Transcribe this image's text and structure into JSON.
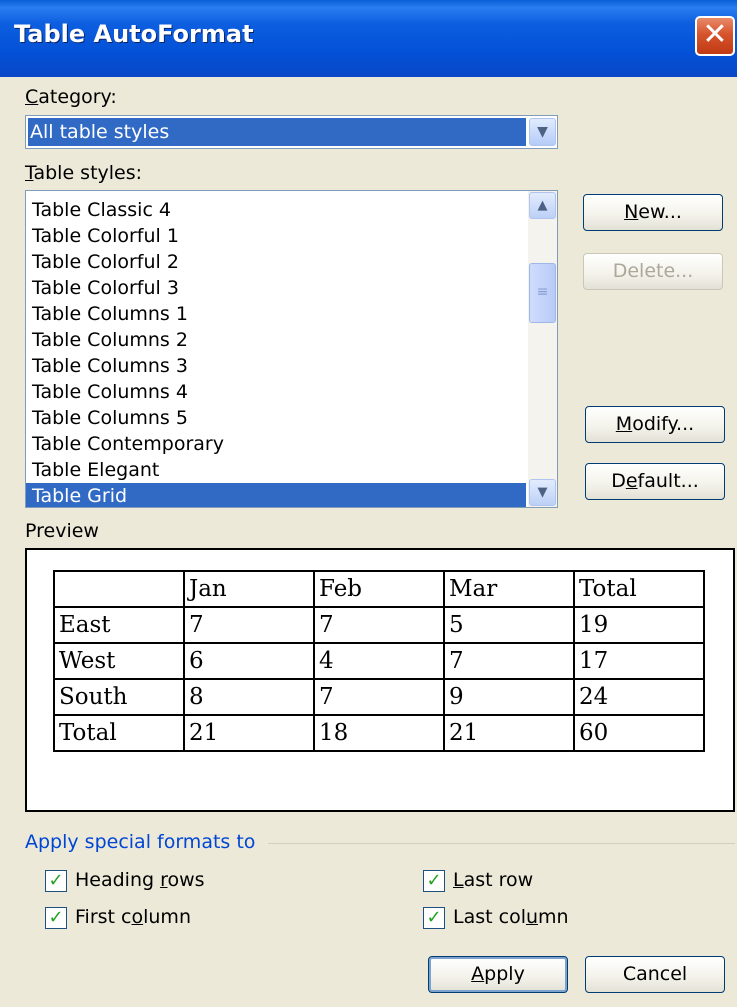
{
  "dialog": {
    "title": "Table AutoFormat",
    "close_glyph": "✕"
  },
  "category": {
    "label_mnemonic": "C",
    "label_rest": "ategory:",
    "value": "All table styles"
  },
  "table_styles": {
    "label_mnemonic": "T",
    "label_rest": "able styles:",
    "items": [
      "Table Classic 4",
      "Table Colorful 1",
      "Table Colorful 2",
      "Table Colorful 3",
      "Table Columns 1",
      "Table Columns 2",
      "Table Columns 3",
      "Table Columns 4",
      "Table Columns 5",
      "Table Contemporary",
      "Table Elegant",
      "Table Grid"
    ],
    "selected": "Table Grid"
  },
  "buttons": {
    "new_mnemonic": "N",
    "new_rest": "ew...",
    "delete_label": "Delete...",
    "modify_mnemonic": "M",
    "modify_rest": "odify...",
    "default_pre": "D",
    "default_mnemonic": "e",
    "default_rest": "fault...",
    "apply_mnemonic": "A",
    "apply_rest": "pply",
    "cancel_label": "Cancel"
  },
  "preview": {
    "label": "Preview",
    "rows": [
      [
        "",
        "Jan",
        "Feb",
        "Mar",
        "Total"
      ],
      [
        "East",
        "7",
        "7",
        "5",
        "19"
      ],
      [
        "West",
        "6",
        "4",
        "7",
        "17"
      ],
      [
        "South",
        "8",
        "7",
        "9",
        "24"
      ],
      [
        "Total",
        "21",
        "18",
        "21",
        "60"
      ]
    ]
  },
  "special_formats": {
    "label": "Apply special formats to",
    "check_glyph": "✓",
    "heading_rows": {
      "pre": "Heading ",
      "mnemonic": "r",
      "post": "ows",
      "checked": true
    },
    "first_column": {
      "pre": "First c",
      "mnemonic": "o",
      "post": "lumn",
      "checked": true
    },
    "last_row": {
      "pre": "",
      "mnemonic": "L",
      "post": "ast row",
      "checked": true
    },
    "last_column": {
      "pre": "Last col",
      "mnemonic": "u",
      "post": "mn",
      "checked": true
    }
  },
  "colors": {
    "titlebar": "#0350d6",
    "selection": "#316ac5",
    "dialog_bg": "#ece9d8",
    "group_label": "#0046d5",
    "check": "#21a121"
  }
}
